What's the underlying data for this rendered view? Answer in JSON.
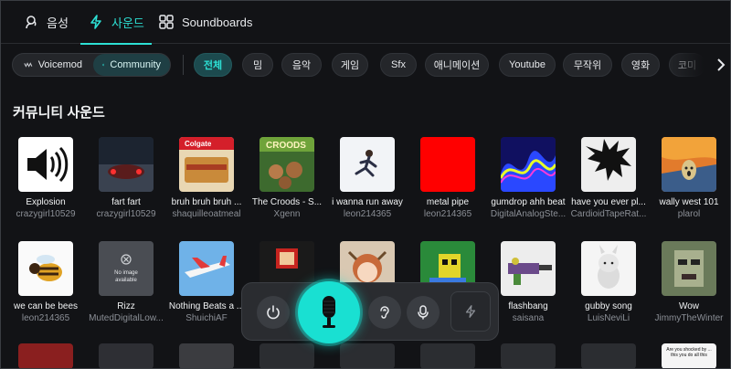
{
  "tabs": [
    {
      "label": "음성",
      "icon": "voice-icon"
    },
    {
      "label": "사운드",
      "icon": "bolt-icon"
    },
    {
      "label": "Soundboards",
      "icon": "grid-icon"
    }
  ],
  "source_toggle": {
    "voicemod": "Voicemod",
    "community": "Community",
    "selected": "Community"
  },
  "categories": [
    "전체",
    "밈",
    "음악",
    "게임",
    "Sfx",
    "애니메이션",
    "Youtube",
    "무작위",
    "영화",
    "코미"
  ],
  "selected_category": "전체",
  "section_title": "커뮤니티 사운드",
  "sounds_row1": [
    {
      "name": "Explosion",
      "author": "crazygirl10529"
    },
    {
      "name": "fart fart",
      "author": "crazygirl10529"
    },
    {
      "name": "bruh bruh bruh ...",
      "author": "shaquilleoatmeal",
      "thumb_text": "Colgate"
    },
    {
      "name": "The Croods - S...",
      "author": "Xgenn",
      "thumb_text": "CROODS"
    },
    {
      "name": "i wanna run away",
      "author": "leon214365"
    },
    {
      "name": "metal pipe",
      "author": "leon214365"
    },
    {
      "name": "gumdrop ahh beat",
      "author": "DigitalAnalogSte..."
    },
    {
      "name": "have you ever pl...",
      "author": "CardioidTapeRat..."
    },
    {
      "name": "wally west 101",
      "author": "plarol"
    }
  ],
  "sounds_row2": [
    {
      "name": "we can be bees",
      "author": "leon214365"
    },
    {
      "name": "Rizz",
      "author": "MutedDigitalLow...",
      "thumb_text": "No image available"
    },
    {
      "name": "Nothing Beats a ...",
      "author": "ShuichiAF"
    },
    {
      "name": "",
      "author": ""
    },
    {
      "name": "",
      "author": ""
    },
    {
      "name": "",
      "author": ""
    },
    {
      "name": "flashbang",
      "author": "saisana"
    },
    {
      "name": "gubby song",
      "author": "LuisNeviLi"
    },
    {
      "name": "Wow",
      "author": "JimmyTheWinter"
    }
  ],
  "row3_thumb_text": "Are you shocked by ... this you do all this",
  "colors": {
    "accent": "#2de0d4",
    "background": "#121316",
    "mic": "#19e0d2"
  }
}
